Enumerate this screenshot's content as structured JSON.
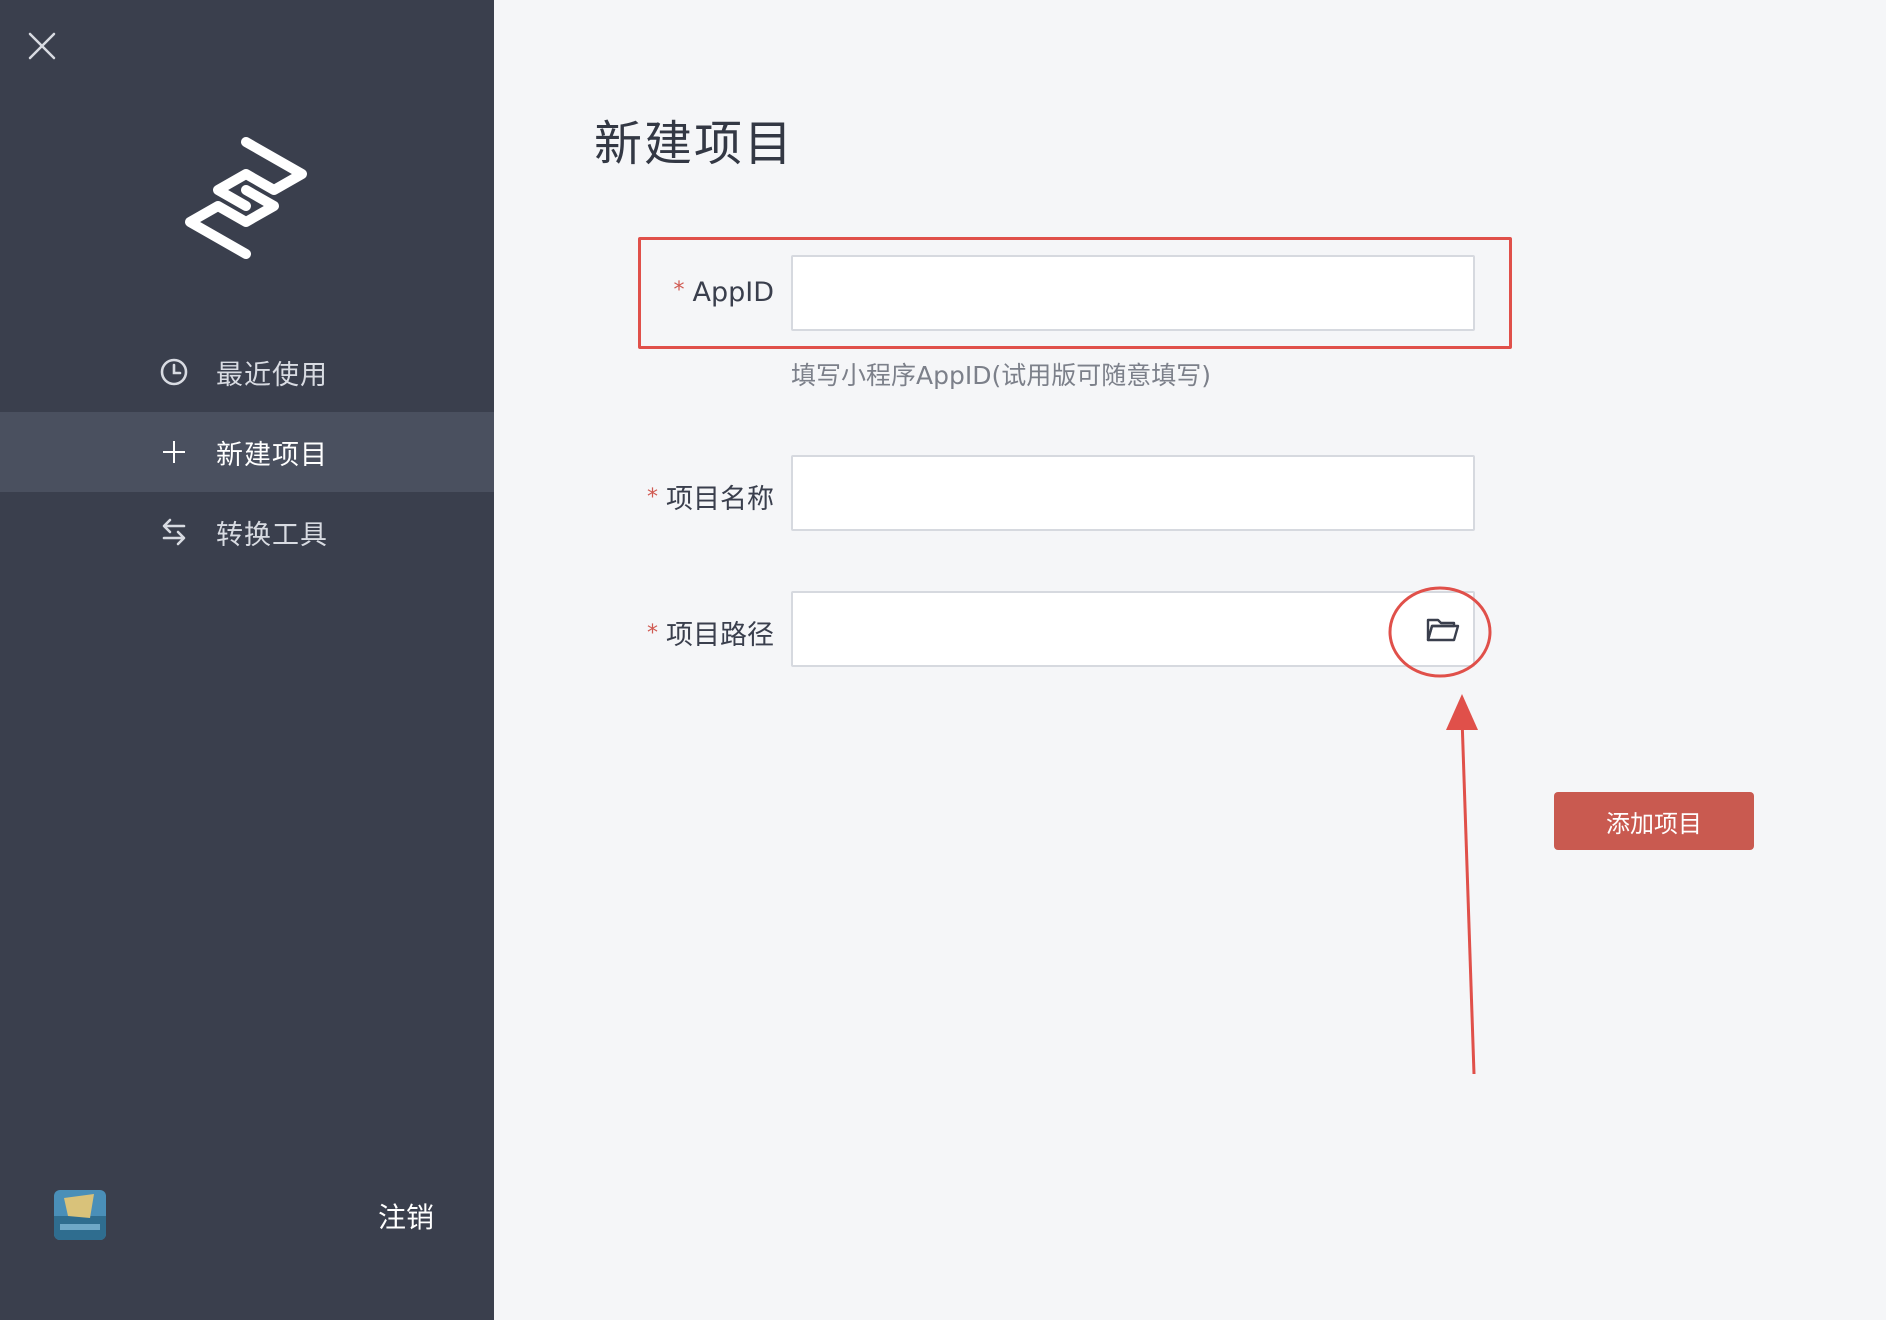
{
  "sidebar": {
    "items": [
      {
        "label": "最近使用",
        "icon": "clock-icon"
      },
      {
        "label": "新建项目",
        "icon": "plus-icon"
      },
      {
        "label": "转换工具",
        "icon": "swap-icon"
      }
    ],
    "logout_label": "注销"
  },
  "main": {
    "title": "新建项目",
    "fields": {
      "appid": {
        "label": "AppID",
        "required": "*",
        "value": "",
        "hint": "填写小程序AppID(试用版可随意填写)"
      },
      "name": {
        "label": "项目名称",
        "required": "*",
        "value": ""
      },
      "path": {
        "label": "项目路径",
        "required": "*",
        "value": ""
      }
    },
    "add_button_label": "添加项目"
  },
  "colors": {
    "sidebar_bg": "#3a3f4d",
    "sidebar_active": "#4a505f",
    "content_bg": "#f5f6f8",
    "accent": "#c95a50",
    "annotation": "#e0504a"
  }
}
